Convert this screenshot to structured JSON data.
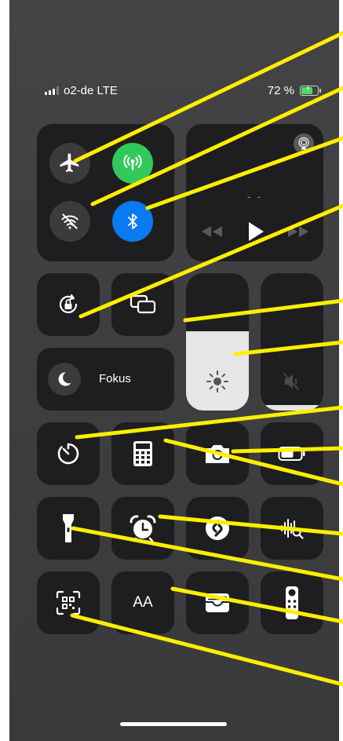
{
  "status": {
    "carrier": "o2-de LTE",
    "battery_percent": "72 %",
    "battery_level": 0.72,
    "battery_color": "#4cd964"
  },
  "connectivity": {
    "airplane": {
      "icon": "airplane-icon",
      "on": false
    },
    "cellular": {
      "icon": "cellular-antenna-icon",
      "on": true,
      "color": "#32c85a"
    },
    "wifi": {
      "icon": "wifi-off-icon",
      "on": false
    },
    "bluetooth": {
      "icon": "bluetooth-icon",
      "on": true,
      "color": "#0a7af0"
    }
  },
  "now_playing": {
    "title": "- -",
    "airplay_icon": "airplay-icon"
  },
  "focus": {
    "label": "Fokus",
    "icon": "moon-icon"
  },
  "brightness": {
    "level": 0.58,
    "icon": "sun-icon"
  },
  "volume": {
    "level": 0.04,
    "icon": "speaker-muted-icon"
  },
  "controls": [
    {
      "name": "orientation-lock",
      "icon": "orientation-lock-icon"
    },
    {
      "name": "screen-mirroring",
      "icon": "screen-mirroring-icon"
    },
    {
      "name": "timer",
      "icon": "timer-icon"
    },
    {
      "name": "calculator",
      "icon": "calculator-icon"
    },
    {
      "name": "camera",
      "icon": "camera-icon"
    },
    {
      "name": "low-power",
      "icon": "battery-icon"
    },
    {
      "name": "flashlight",
      "icon": "flashlight-icon"
    },
    {
      "name": "alarm",
      "icon": "alarm-clock-icon"
    },
    {
      "name": "shazam",
      "icon": "shazam-icon"
    },
    {
      "name": "sound-recognition",
      "icon": "sound-recognition-icon"
    },
    {
      "name": "code-scanner",
      "icon": "qr-scanner-icon"
    },
    {
      "name": "text-size",
      "icon": "text-size-icon",
      "label": "AA"
    },
    {
      "name": "wallet",
      "icon": "wallet-icon"
    },
    {
      "name": "apple-tv-remote",
      "icon": "tv-remote-icon"
    }
  ],
  "annotation_color": "#ffee00"
}
